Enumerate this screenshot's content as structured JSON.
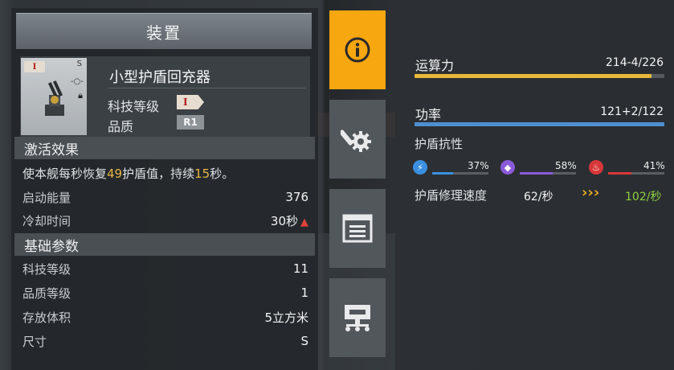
{
  "panel_title": "装置",
  "item": {
    "name": "小型护盾回充器",
    "tag": "I",
    "slot_size": "S",
    "tech_level_label": "科技等级",
    "tech_level_badge": "I",
    "quality_label": "品质",
    "quality_badge": "R1"
  },
  "activation": {
    "header": "激活效果",
    "desc_prefix": "使本舰每秒恢复",
    "desc_value1": "49",
    "desc_mid": "护盾值，持续",
    "desc_value2": "15",
    "desc_suffix": "秒。",
    "rows": [
      {
        "label": "启动能量",
        "value": "376"
      },
      {
        "label": "冷却时间",
        "value": "30秒"
      }
    ]
  },
  "basic": {
    "header": "基础参数",
    "rows": [
      {
        "label": "科技等级",
        "value": "11"
      },
      {
        "label": "品质等级",
        "value": "1"
      },
      {
        "label": "存放体积",
        "value": "5立方米"
      },
      {
        "label": "尺寸",
        "value": "S"
      }
    ]
  },
  "tabs": [
    {
      "icon": "info-icon",
      "active": true
    },
    {
      "icon": "gear-wrench-icon",
      "active": false
    },
    {
      "icon": "document-icon",
      "active": false
    },
    {
      "icon": "module-tree-icon",
      "active": false
    }
  ],
  "stats": {
    "compute_label": "运算力",
    "compute_value": "214-4/226",
    "compute_fill": 0.947,
    "compute_color": "#e8b93a",
    "power_label": "功率",
    "power_value": "121+2/122",
    "power_fill": 1.0,
    "power_color": "#4f8fd0",
    "shield_res_label": "护盾抗性",
    "resistances": [
      {
        "icon": "lightning-icon",
        "color": "#3b8fe0",
        "percent": "37%",
        "fill": 0.37
      },
      {
        "icon": "crystal-icon",
        "color": "#8a5ad8",
        "percent": "58%",
        "fill": 0.58
      },
      {
        "icon": "fire-icon",
        "color": "#d8373a",
        "percent": "41%",
        "fill": 0.41
      }
    ],
    "repair_label": "护盾修理速度",
    "repair_before": "62/秒",
    "repair_arrow": "›››",
    "repair_after": "102/秒",
    "repair_after_color": "#8ccf3d"
  }
}
